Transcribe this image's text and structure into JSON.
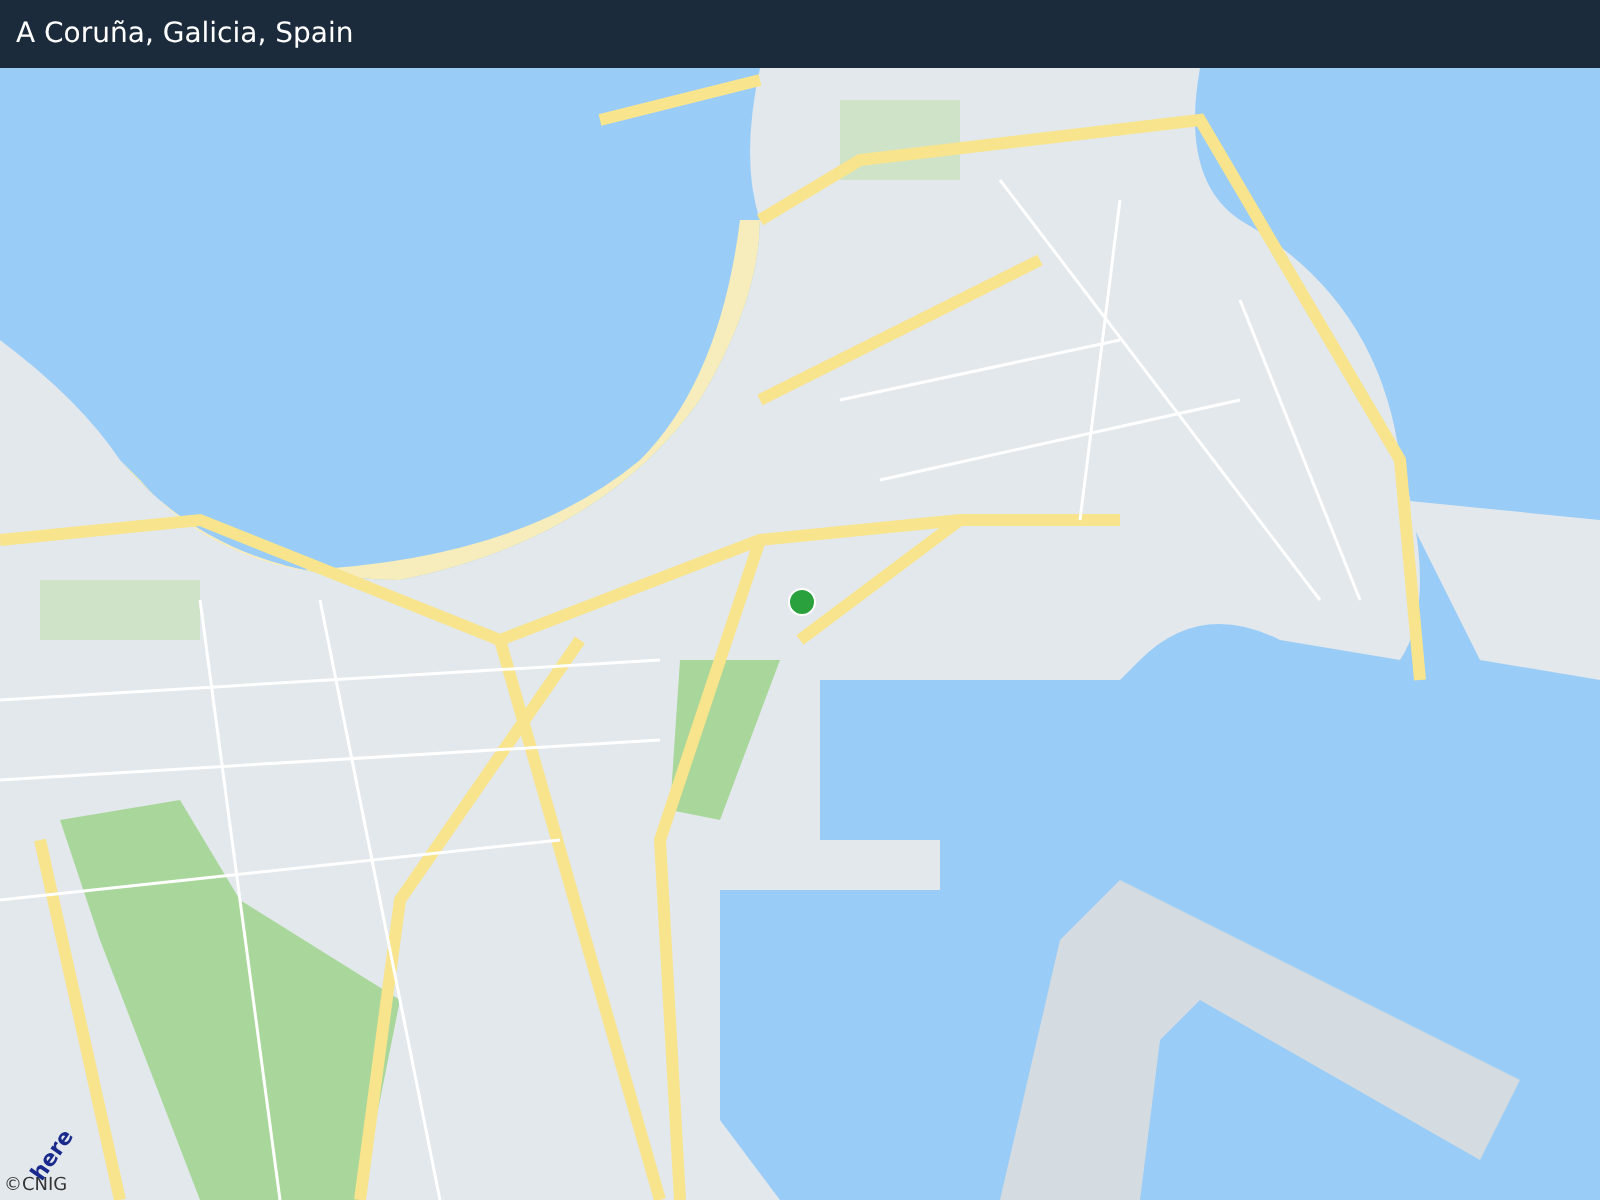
{
  "header": {
    "title": "A Coruña, Galicia, Spain"
  },
  "map": {
    "attribution": {
      "logo": "here",
      "copyright": "©CNIG"
    }
  }
}
